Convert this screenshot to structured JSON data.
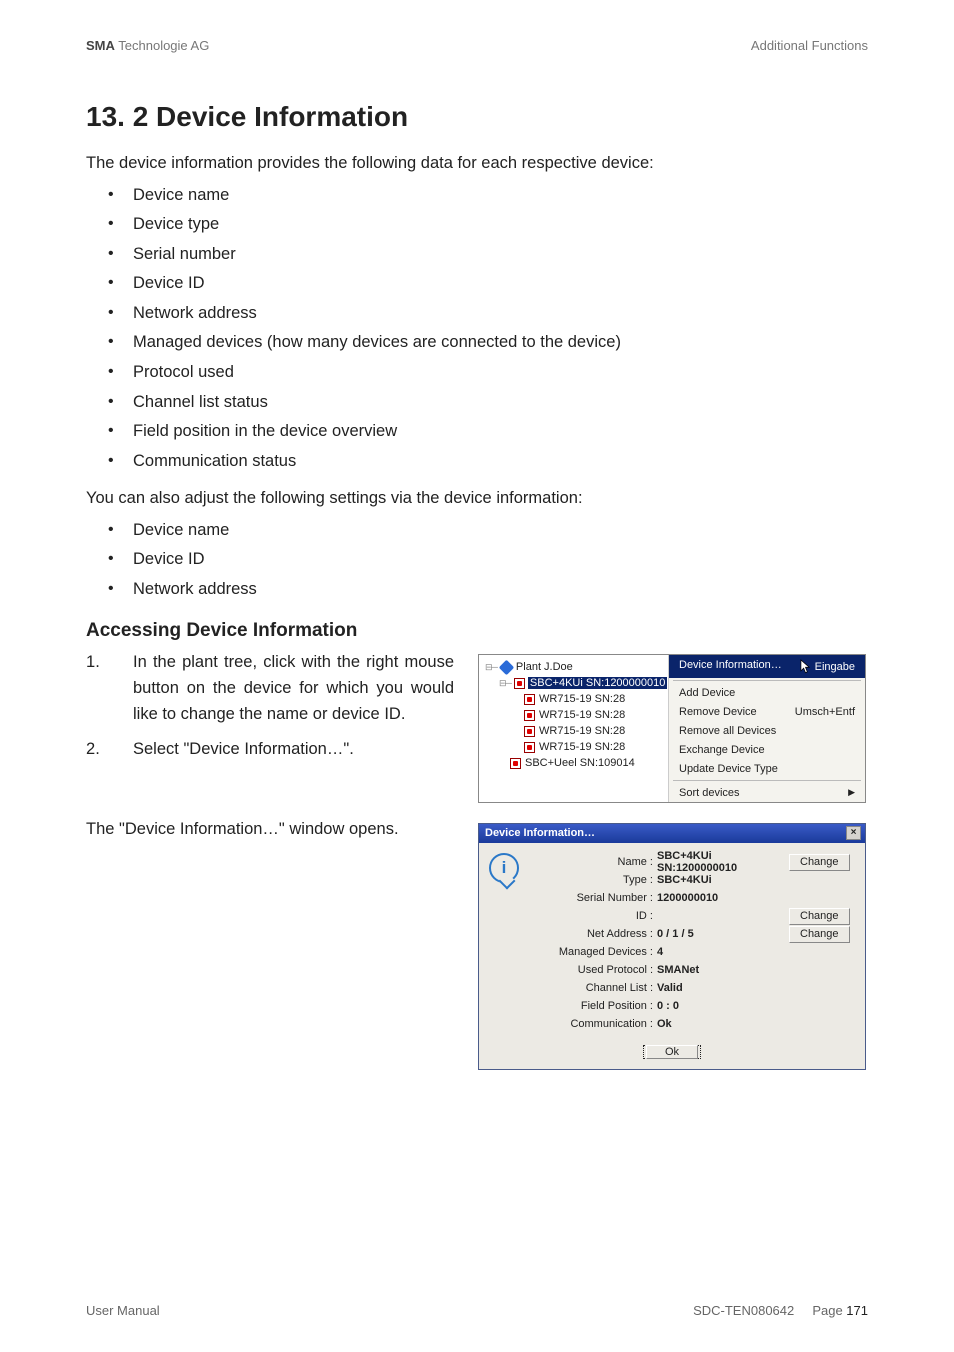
{
  "header": {
    "brand_bold": "SMA",
    "brand_rest": " Technologie AG",
    "right": "Additional Functions"
  },
  "title": "13. 2 Device Information",
  "intro": "The device information provides the following data for each respective device:",
  "list1": [
    "Device name",
    "Device type",
    "Serial number",
    "Device ID",
    "Network address",
    "Managed devices (how many devices are connected to the device)",
    "Protocol used",
    "Channel list status",
    "Field position in the device overview",
    "Communication status"
  ],
  "adjust_intro": "You can also adjust the following settings via the device information:",
  "list2": [
    "Device name",
    "Device ID",
    "Network address"
  ],
  "subhead": "Accessing Device Information",
  "steps": [
    "In the plant tree, click with the right mouse button on the device for which you would like to change the name or device ID.",
    "Select \"Device Information…\"."
  ],
  "result_text": "The \"Device Information…\" window opens.",
  "tree": {
    "root": "Plant J.Doe",
    "selected": "SBC+4KUi SN:1200000010",
    "children": [
      "WR715-19 SN:28",
      "WR715-19 SN:28",
      "WR715-19 SN:28",
      "WR715-19 SN:28"
    ],
    "sibling": "SBC+Ueel SN:109014"
  },
  "ctx": {
    "items": [
      {
        "label": "Device Information…",
        "shortcut": "Eingabe",
        "hi": true
      },
      {
        "label": "Add Device"
      },
      {
        "label": "Remove Device",
        "shortcut": "Umsch+Entf"
      },
      {
        "label": "Remove all Devices"
      },
      {
        "label": "Exchange Device"
      },
      {
        "label": "Update Device Type"
      }
    ],
    "last": {
      "label": "Sort devices",
      "arrow": "▶"
    }
  },
  "dlg": {
    "title": "Device Information…",
    "rows": [
      {
        "lbl": "Name :",
        "val": "SBC+4KUi SN:1200000010",
        "btn": "Change"
      },
      {
        "lbl": "Type :",
        "val": "SBC+4KUi"
      },
      {
        "lbl": "Serial Number :",
        "val": "1200000010"
      },
      {
        "lbl": "ID :",
        "val": "",
        "btn": "Change"
      },
      {
        "lbl": "Net Address :",
        "val": "0 / 1 / 5",
        "btn": "Change"
      },
      {
        "lbl": "Managed Devices :",
        "val": "4"
      },
      {
        "lbl": "Used Protocol :",
        "val": "SMANet"
      },
      {
        "lbl": "Channel List :",
        "val": "Valid"
      },
      {
        "lbl": "Field Position :",
        "val": "0 : 0"
      },
      {
        "lbl": "Communication :",
        "val": "Ok"
      }
    ],
    "ok": "Ok"
  },
  "footer": {
    "left": "User Manual",
    "mid": "SDC-TEN080642",
    "page_label": "Page ",
    "page_no": "171"
  }
}
